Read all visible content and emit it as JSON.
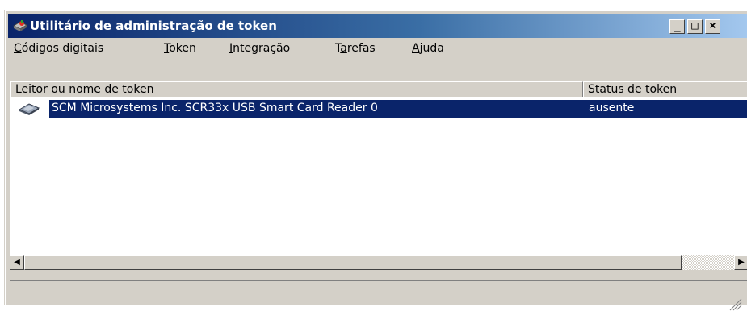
{
  "window": {
    "title": "Utilitário de administração de token",
    "buttons": {
      "minimize": "_",
      "maximize": "□",
      "close": "×"
    }
  },
  "menu": [
    {
      "pre": "",
      "key": "C",
      "rest": "ódigos digitais"
    },
    {
      "pre": "",
      "key": "T",
      "rest": "oken"
    },
    {
      "pre": "",
      "key": "I",
      "rest": "ntegração"
    },
    {
      "pre": "T",
      "key": "a",
      "rest": "refas"
    },
    {
      "pre": "",
      "key": "A",
      "rest": "juda"
    }
  ],
  "list": {
    "columns": [
      "Leitor ou nome de token",
      "Status de token"
    ],
    "rows": [
      {
        "name": "SCM Microsystems Inc. SCR33x USB Smart Card Reader 0",
        "status": "ausente",
        "selected": true,
        "icon": "card-reader-icon"
      }
    ]
  },
  "scrollbar": {
    "left_arrow": "◀",
    "right_arrow": "▶"
  },
  "colors": {
    "titlebar": "#0a246a",
    "selection": "#0a246a",
    "face": "#d4d0c8"
  },
  "icons": {
    "app": "token-utility-icon",
    "resize": "size-grip-icon"
  }
}
